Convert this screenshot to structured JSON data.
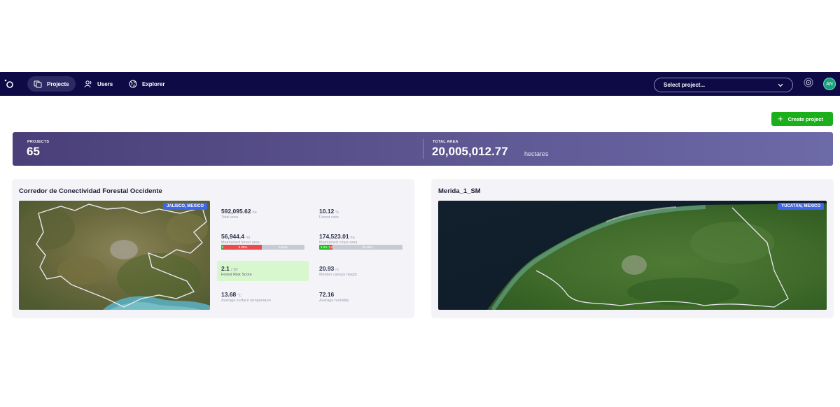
{
  "nav": {
    "items": [
      {
        "label": "Projects",
        "icon": "projects-icon",
        "active": true
      },
      {
        "label": "Users",
        "icon": "users-icon",
        "active": false
      },
      {
        "label": "Explorer",
        "icon": "globe-icon",
        "active": false
      }
    ],
    "select_project_placeholder": "Select project...",
    "avatar_initials": "AN"
  },
  "actions": {
    "create_project": "Create project"
  },
  "summary": {
    "projects_label": "PROJECTS",
    "projects_value": "65",
    "area_label": "TOTAL AREA",
    "area_value": "20,005,012.77",
    "area_unit": "hectares"
  },
  "cards": [
    {
      "title": "Corredor de Conectividad Forestal Occidente",
      "region": "JALISCO, MEXICO",
      "stats": {
        "total_area": {
          "value": "592,095.62",
          "unit": "ha",
          "label": "Total area"
        },
        "forest_ratio": {
          "value": "10.12",
          "unit": "%",
          "label": "Forest ratio"
        },
        "maintained_forest": {
          "value": "56,944.4",
          "unit": "ha",
          "label": "Maintained forest area",
          "bar": {
            "green": "0",
            "red": "8.35%",
            "grey": "9.62%"
          }
        },
        "maintained_crops": {
          "value": "174,523.01",
          "unit": "ha",
          "label": "Maintained crops area",
          "bar": {
            "green": "3.8%",
            "red": "2.0",
            "grey": "29.48%"
          }
        },
        "risk": {
          "value": "2.1",
          "unit": "/ 10",
          "label": "Forest Risk Score"
        },
        "canopy": {
          "value": "20.93",
          "unit": "m",
          "label": "Median canopy height"
        },
        "surface_temp": {
          "value": "13.68",
          "unit": "°C",
          "label": "Average surface temperature"
        },
        "humidity": {
          "value": "72.16",
          "unit": "",
          "label": "Average humidity"
        }
      }
    },
    {
      "title": "Merida_1_SM",
      "region": "YUCATÁN, MEXICO"
    }
  ],
  "colors": {
    "nav_bg": "#0d0a45",
    "accent_green": "#1bb01b",
    "badge_blue": "#3f66e6",
    "bar_red": "#e84c4c",
    "risk_bg": "#d8f7cf"
  }
}
